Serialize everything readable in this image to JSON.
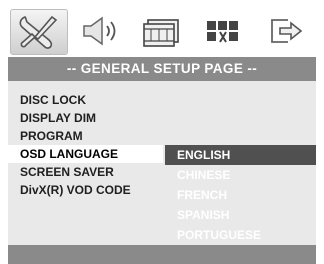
{
  "tabs": [
    {
      "name": "general-setup",
      "icon": "tools-icon",
      "active": true
    },
    {
      "name": "audio-setup",
      "icon": "speaker-icon",
      "active": false
    },
    {
      "name": "video-setup",
      "icon": "film-icon",
      "active": false
    },
    {
      "name": "preference",
      "icon": "preference-icon",
      "active": false
    },
    {
      "name": "exit",
      "icon": "exit-icon",
      "active": false
    }
  ],
  "title": "-- GENERAL SETUP PAGE --",
  "menu": {
    "items": [
      "DISC LOCK",
      "DISPLAY DIM",
      "PROGRAM",
      "OSD LANGUAGE",
      "SCREEN SAVER",
      "DivX(R) VOD CODE"
    ],
    "selected": "OSD LANGUAGE"
  },
  "language_options": {
    "items": [
      "ENGLISH",
      "CHINESE",
      "FRENCH",
      "SPANISH",
      "PORTUGUESE"
    ],
    "selected": "ENGLISH"
  },
  "colors": {
    "title_bar": "#8a8a8a",
    "panel": "#e9e9e9",
    "highlight": "#505050",
    "text_light": "#ffffff",
    "text_dark": "#202020"
  }
}
